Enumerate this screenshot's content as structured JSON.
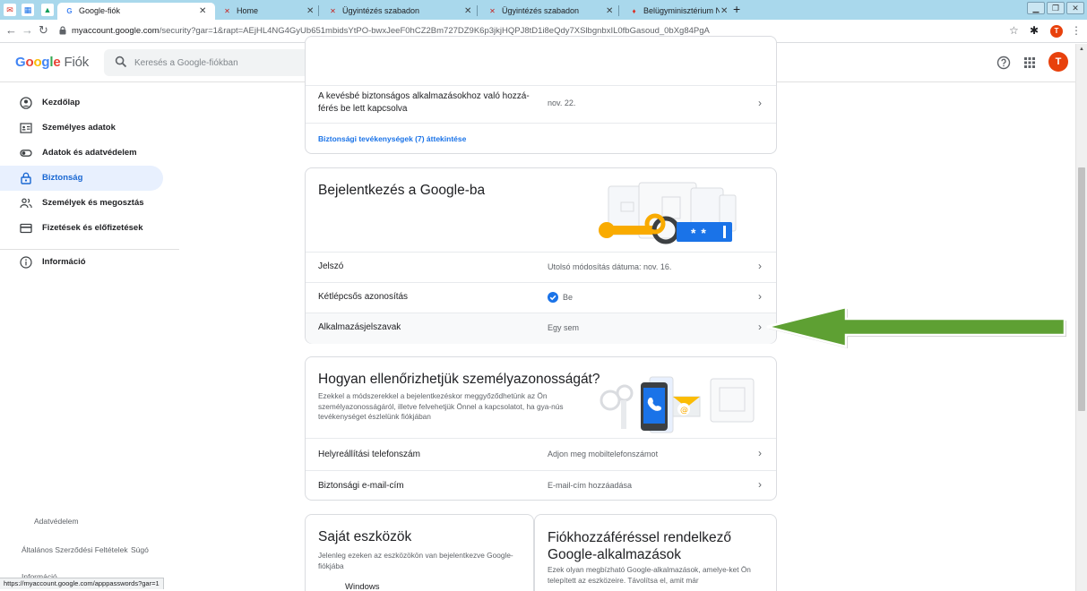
{
  "browser": {
    "tabs": [
      {
        "title": "Google-fiók",
        "active": true
      },
      {
        "title": "Home",
        "active": false
      },
      {
        "title": "Ügyintézés szabadon",
        "active": false
      },
      {
        "title": "Ügyintézés szabadon",
        "active": false
      },
      {
        "title": "Belügyminisztérium Nyilvántartá",
        "active": false
      }
    ],
    "new_tab_label": "+",
    "url_host": "myaccount.google.com",
    "url_path": "/security?gar=1&rapt=AEjHL4NG4GyUb651mbidsYtPO-bwxJeeF0hCZ2Bm727DZ9K6p3jkjHQPJ8tD1i8eQdy7XSlbgnbxIL0fbGasoud_0bXg84PgA",
    "profile_initial": "T",
    "status_url": "https://myaccount.google.com/apppasswords?gar=1"
  },
  "header": {
    "logo_letters": [
      "G",
      "o",
      "o",
      "g",
      "l",
      "e"
    ],
    "product": "Fiók",
    "search_placeholder": "Keresés a Google-fiókban",
    "avatar_initial": "T"
  },
  "sidebar": {
    "items": [
      {
        "label": "Kezdőlap",
        "icon": "home-icon",
        "active": false
      },
      {
        "label": "Személyes adatok",
        "icon": "id-card-icon",
        "active": false
      },
      {
        "label": "Adatok és adatvédelem",
        "icon": "toggle-icon",
        "active": false
      },
      {
        "label": "Biztonság",
        "icon": "lock-icon",
        "active": true
      },
      {
        "label": "Személyek és megosztás",
        "icon": "people-icon",
        "active": false
      },
      {
        "label": "Fizetések és előfizetések",
        "icon": "credit-card-icon",
        "active": false
      },
      {
        "label": "Információ",
        "icon": "info-icon",
        "active": false
      }
    ],
    "footer": {
      "privacy": "Adatvédelem",
      "terms": "Általános Szerződési Feltételek",
      "help": "Súgó",
      "info": "Információ"
    }
  },
  "activity_card": {
    "row_text": "A kevésbé biztonságos alkalmazásokhoz való hozzá-férés be lett kapcsolva",
    "row_date": "nov. 22.",
    "review_link": "Biztonsági tevékenységek (7) áttekintése"
  },
  "signin_card": {
    "title": "Bejelentkezés a Google-ba",
    "rows": [
      {
        "label": "Jelszó",
        "value": "Utolsó módosítás dátuma: nov. 16."
      },
      {
        "label": "Kétlépcsős azonosítás",
        "value": "Be"
      },
      {
        "label": "Alkalmazásjelszavak",
        "value": "Egy sem"
      }
    ],
    "password_mask": "* *"
  },
  "verify_card": {
    "title": "Hogyan ellenőrizhetjük személyazonosságát?",
    "desc": "Ezekkel a módszerekkel a bejelentkezéskor meggyőződhetünk az Ön személyazonosságáról, illetve felvehetjük Önnel a kapcsolatot, ha gya-nús tevékenységet észlelünk fiókjában",
    "rows": [
      {
        "label": "Helyreállítási telefonszám",
        "value": "Adjon meg mobiltelefonszámot"
      },
      {
        "label": "Biztonsági e-mail-cím",
        "value": "E-mail-cím hozzáadása"
      }
    ]
  },
  "devices_card": {
    "title": "Saját eszközök",
    "desc": "Jelenleg ezeken az eszközökön van bejelentkezve Google-fiókjába",
    "first_device": "Windows"
  },
  "thirdparty_card": {
    "title": "Fiókhozzáféréssel rendelkező Google-alkalmazások",
    "desc": "Ezek olyan megbízható Google-alkalmazások, amelye-ket Ön telepített az eszközeire. Távolítsa el, amit már"
  },
  "colors": {
    "accent_blue": "#1a73e8",
    "active_bg": "#e8f0fe",
    "annotation_green": "#5ea033",
    "tabstrip": "#a9d8ec"
  }
}
